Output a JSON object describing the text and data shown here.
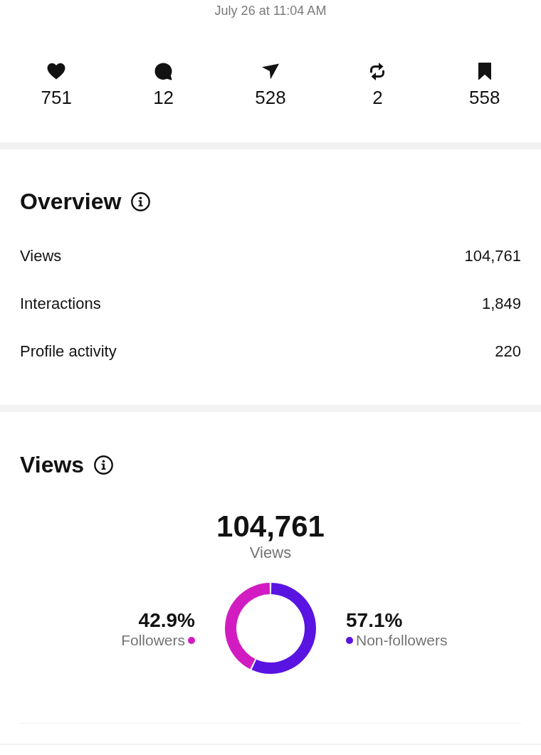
{
  "timestamp": "July 26 at 11:04 AM",
  "stats": [
    {
      "kind": "likes",
      "value": "751"
    },
    {
      "kind": "comments",
      "value": "12"
    },
    {
      "kind": "shares",
      "value": "528"
    },
    {
      "kind": "reposts",
      "value": "2"
    },
    {
      "kind": "saves",
      "value": "558"
    }
  ],
  "overview": {
    "title": "Overview",
    "rows": [
      {
        "label": "Views",
        "value": "104,761"
      },
      {
        "label": "Interactions",
        "value": "1,849"
      },
      {
        "label": "Profile activity",
        "value": "220"
      }
    ]
  },
  "views": {
    "title": "Views",
    "total": "104,761",
    "total_label": "Views",
    "chart_data": {
      "type": "donut",
      "categories": [
        "Followers",
        "Non-followers"
      ],
      "values": [
        42.9,
        57.1
      ],
      "value_labels": [
        "42.9%",
        "57.1%"
      ],
      "colors": [
        "#d21cc2",
        "#5a14e2"
      ]
    }
  }
}
